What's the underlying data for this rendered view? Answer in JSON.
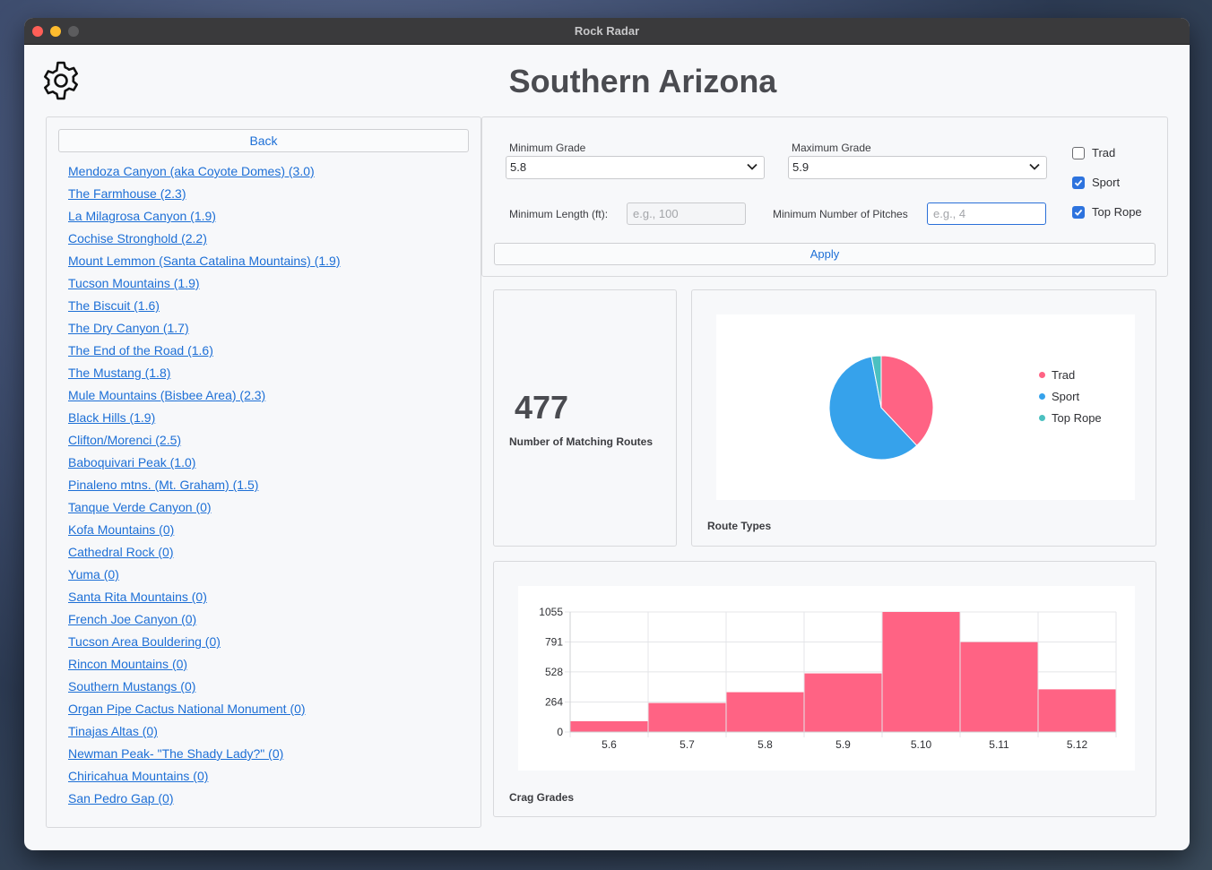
{
  "window": {
    "title": "Rock Radar"
  },
  "header": {
    "title": "Southern Arizona",
    "settings_icon": "gear-icon"
  },
  "left": {
    "back_label": "Back",
    "crags": [
      "Mendoza Canyon (aka Coyote Domes) (3.0)",
      "The Farmhouse (2.3)",
      "La Milagrosa Canyon (1.9)",
      "Cochise Stronghold (2.2)",
      "Mount Lemmon (Santa Catalina Mountains) (1.9)",
      "Tucson Mountains (1.9)",
      "The Biscuit (1.6)",
      "The Dry Canyon (1.7)",
      "The End of the Road (1.6)",
      "The Mustang (1.8)",
      "Mule Mountains (Bisbee Area) (2.3)",
      "Black Hills (1.9)",
      "Clifton/Morenci (2.5)",
      "Baboquivari Peak (1.0)",
      "Pinaleno mtns. (Mt. Graham) (1.5)",
      "Tanque Verde Canyon (0)",
      "Kofa Mountains (0)",
      "Cathedral Rock (0)",
      "Yuma (0)",
      "Santa Rita Mountains (0)",
      "French Joe Canyon (0)",
      "Tucson Area Bouldering (0)",
      "Rincon Mountains (0)",
      "Southern Mustangs (0)",
      "Organ Pipe Cactus National Monument (0)",
      "Tinajas Altas (0)",
      "Newman Peak- \"The Shady Lady?\" (0)",
      "Chiricahua Mountains (0)",
      "San Pedro Gap (0)"
    ]
  },
  "filters": {
    "min_grade_label": "Minimum Grade",
    "min_grade_value": "5.8",
    "max_grade_label": "Maximum Grade",
    "max_grade_value": "5.9",
    "min_length_label": "Minimum Length (ft):",
    "min_length_placeholder": "e.g., 100",
    "min_pitches_label": "Minimum Number of Pitches",
    "min_pitches_placeholder": "e.g., 4",
    "types": [
      {
        "label": "Trad",
        "checked": false
      },
      {
        "label": "Sport",
        "checked": true
      },
      {
        "label": "Top Rope",
        "checked": true
      }
    ],
    "apply_label": "Apply"
  },
  "stats": {
    "count": "477",
    "count_label": "Number of Matching Routes",
    "pie_title": "Route Types",
    "hist_title": "Crag Grades"
  },
  "colors": {
    "trad": "#ff6384",
    "sport": "#36a2eb",
    "toprope": "#4bc0c0",
    "accent": "#1d6fd6"
  },
  "chart_data": [
    {
      "type": "pie",
      "title": "Route Types",
      "categories": [
        "Trad",
        "Sport",
        "Top Rope"
      ],
      "values": [
        38,
        59,
        3
      ],
      "legend": "right"
    },
    {
      "type": "bar",
      "title": "Crag Grades",
      "categories": [
        "5.6",
        "5.7",
        "5.8",
        "5.9",
        "5.10",
        "5.11",
        "5.12"
      ],
      "values": [
        95,
        255,
        350,
        515,
        1055,
        790,
        375
      ],
      "yticks": [
        "0",
        "264",
        "528",
        "791",
        "1055"
      ],
      "ylim": [
        0,
        1055
      ],
      "grid": true
    }
  ]
}
